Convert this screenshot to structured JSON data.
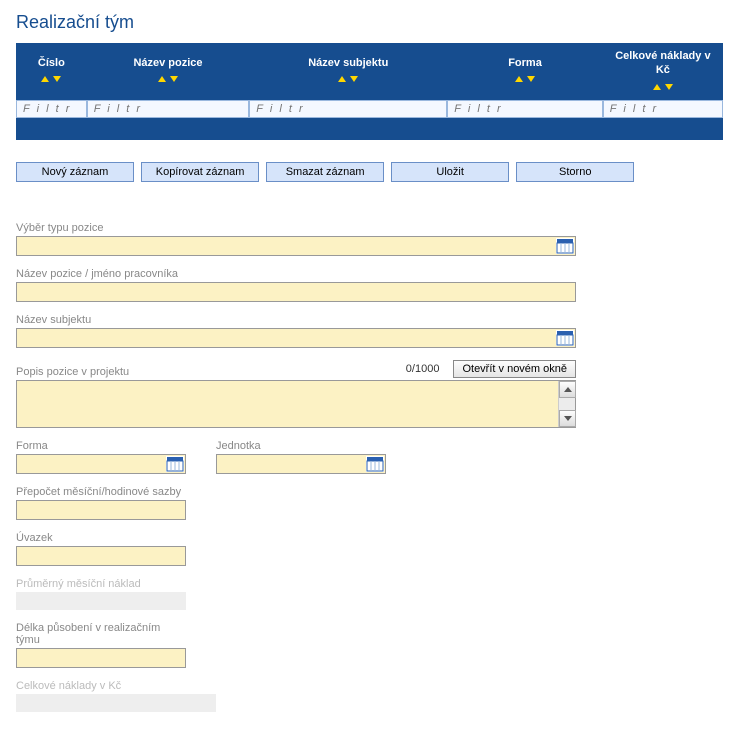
{
  "title": "Realizační tým",
  "grid": {
    "columns": [
      {
        "label": "Číslo"
      },
      {
        "label": "Název pozice"
      },
      {
        "label": "Název subjektu"
      },
      {
        "label": "Forma"
      },
      {
        "label": "Celkové náklady v Kč"
      }
    ],
    "filterPlaceholder": "F i l t r"
  },
  "buttons": {
    "new": "Nový záznam",
    "copy": "Kopírovat záznam",
    "delete": "Smazat záznam",
    "save": "Uložit",
    "cancel": "Storno"
  },
  "form": {
    "positionType": {
      "label": "Výběr typu pozice",
      "value": ""
    },
    "positionName": {
      "label": "Název pozice / jméno pracovníka",
      "value": ""
    },
    "subjectName": {
      "label": "Název subjektu",
      "value": ""
    },
    "description": {
      "label": "Popis pozice v projektu",
      "value": "",
      "counter": "0/1000",
      "openBtn": "Otevřít v novém okně"
    },
    "form": {
      "label": "Forma",
      "value": ""
    },
    "unit": {
      "label": "Jednotka",
      "value": ""
    },
    "rateRecalc": {
      "label": "Přepočet měsíční/hodinové sazby",
      "value": ""
    },
    "allocation": {
      "label": "Úvazek",
      "value": ""
    },
    "avgMonthly": {
      "label": "Průměrný měsíční náklad",
      "value": ""
    },
    "duration": {
      "label": "Délka působení v realizačním týmu",
      "value": ""
    },
    "totalCosts": {
      "label": "Celkové náklady v Kč",
      "value": ""
    }
  }
}
